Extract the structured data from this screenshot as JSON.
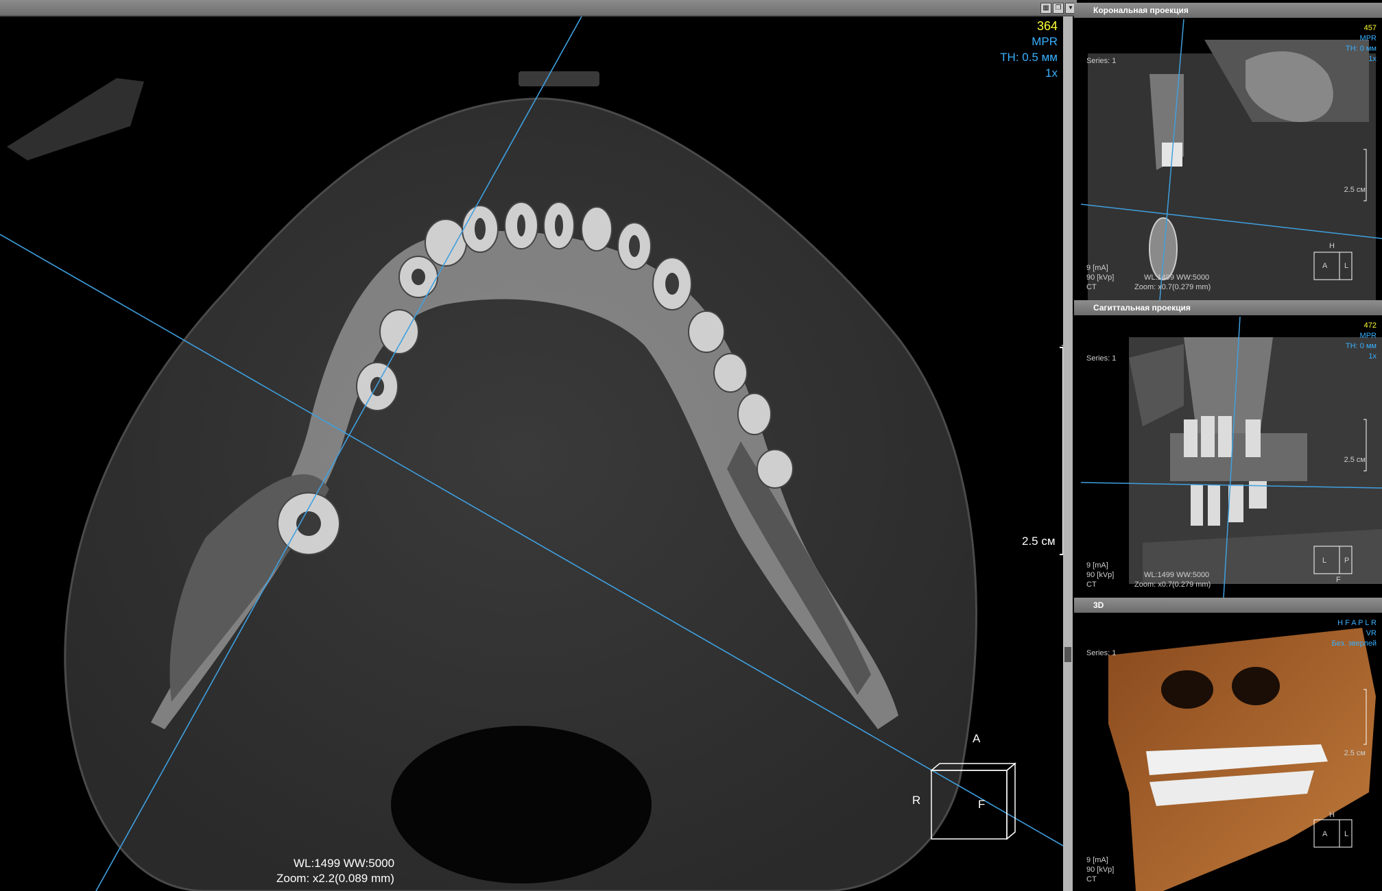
{
  "main_view": {
    "slice_number": "364",
    "mode": "MPR",
    "thickness": "TH: 0.5 мм",
    "zoom_factor": "1x",
    "window_level": "WL:1499 WW:5000",
    "zoom": "Zoom: x2.2(0.089 mm)",
    "scale_label": "2.5 см",
    "orientation": {
      "top": "A",
      "left": "R",
      "front": "F"
    }
  },
  "panels": {
    "coronal": {
      "title": "Корональная проекция",
      "slice_number": "457",
      "mode": "MPR",
      "thickness": "TH: 0 мм",
      "zoom_factor": "1x",
      "series": "Series: 1",
      "scale_label": "2.5 см",
      "ma": "9 [mA]",
      "kvp": "90 [kVp]",
      "modality": "CT",
      "window_level": "WL:1499 WW:5000",
      "zoom": "Zoom: x0.7(0.279 mm)",
      "orientation": {
        "top": "H",
        "left": "A",
        "right": "L"
      }
    },
    "sagittal": {
      "title": "Сагиттальная проекция",
      "slice_number": "472",
      "mode": "MPR",
      "thickness": "TH: 0 мм",
      "zoom_factor": "1x",
      "series": "Series: 1",
      "scale_label": "2.5 см",
      "ma": "9 [mA]",
      "kvp": "90 [kVp]",
      "modality": "CT",
      "window_level": "WL:1499 WW:5000",
      "zoom": "Zoom: x0.7(0.279 mm)",
      "orientation": {
        "left": "L",
        "right": "P",
        "bottom": "F"
      }
    },
    "view3d": {
      "title": "3D",
      "orientation_line": "H F A P L R",
      "mode": "VR",
      "preset": "Без. зверлей",
      "series": "Series: 1",
      "scale_label": "2.5 см",
      "ma": "9 [mA]",
      "kvp": "90 [kVp]",
      "modality": "CT",
      "orientation": {
        "top": "H",
        "left": "A",
        "right": "L"
      }
    }
  },
  "colors": {
    "accent": "#39b0ff",
    "slice_number": "#ffff33",
    "panel_header": "#7a7a7a"
  },
  "icons": [
    "layout-icon",
    "restore-icon",
    "menu-arrow-icon"
  ]
}
